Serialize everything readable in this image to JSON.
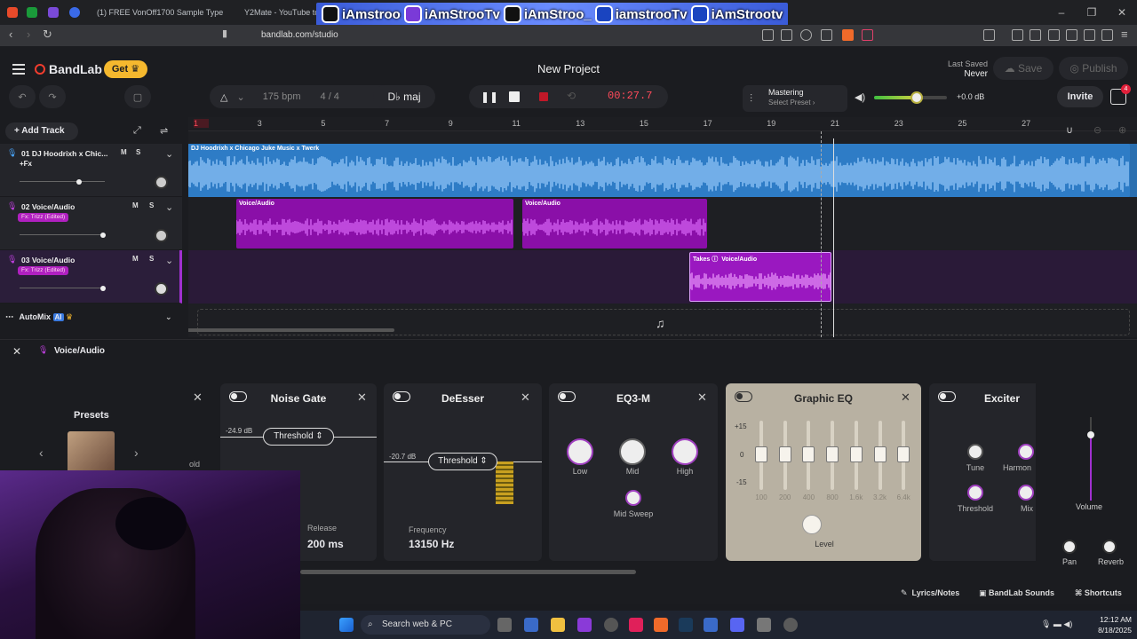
{
  "browser": {
    "tabs": [
      {
        "label": "(1) FREE VonOff1700 Sample Type Be"
      },
      {
        "label": "Y2Mate - YouTube to"
      }
    ],
    "url": "bandlab.com/studio"
  },
  "stream_overlay": {
    "instagram": "iAmstroo",
    "twitch": "iAmStrooTv",
    "tiktok": "iAmStroo_",
    "youtube": "iamstrooTv",
    "x": "iAmStrootv"
  },
  "app": {
    "logo": "BandLab",
    "get_label": "Get",
    "project_title": "New Project",
    "last_saved_label": "Last Saved",
    "last_saved_value": "Never",
    "save_label": "Save",
    "publish_label": "Publish",
    "invite_label": "Invite",
    "notification_count": "4"
  },
  "transport": {
    "bpm": "175",
    "bpm_unit": "bpm",
    "time_sig": "4 / 4",
    "key": "D♭ maj",
    "time": "00:27.7",
    "mastering_title": "Mastering",
    "mastering_sub": "Select Preset",
    "master_db": "+0.0 dB",
    "master_volume_fraction": 0.58
  },
  "tracks": {
    "add_track": "Add Track",
    "items": [
      {
        "name": "01  DJ Hoodrixh x Chic...",
        "sub": "+Fx",
        "clip": "DJ Hoodrixh x Chicago Juke Music x Twerk",
        "vol": 0.7
      },
      {
        "name": "02  Voice/Audio",
        "sub": "Fx: Trizz (Edited)",
        "clip": "Voice/Audio",
        "clip2": "Voice/Audio",
        "vol": 0.98
      },
      {
        "name": "03  Voice/Audio",
        "sub": "Fx: Trizz (Edited)",
        "clip": "Voice/Audio",
        "takes": "Takes",
        "vol": 0.98
      }
    ],
    "mute": "M",
    "solo": "S",
    "automix": "AutoMix",
    "ai": "AI"
  },
  "ruler": [
    "1",
    "3",
    "5",
    "7",
    "9",
    "11",
    "13",
    "15",
    "17",
    "19",
    "21",
    "23",
    "25",
    "27"
  ],
  "fx": {
    "track_label": "Voice/Audio",
    "presets_label": "Presets",
    "noise_gate": {
      "title": "Noise Gate",
      "db": "-24.9 dB",
      "threshold": "Threshold",
      "release_label": "Release",
      "release_value": "200 ms"
    },
    "deesser": {
      "title": "DeEsser",
      "db": "-20.7 dB",
      "threshold": "Threshold",
      "freq_label": "Frequency",
      "freq_value": "13150 Hz"
    },
    "eq3": {
      "title": "EQ3-M",
      "low": "Low",
      "mid": "Mid",
      "high": "High",
      "mid_sweep": "Mid Sweep"
    },
    "graphic_eq": {
      "title": "Graphic EQ",
      "scale": [
        "+15",
        "0",
        "-15"
      ],
      "bands": [
        "100",
        "200",
        "400",
        "800",
        "1.6k",
        "3.2k",
        "6.4k"
      ],
      "level": "Level"
    },
    "exciter": {
      "title": "Exciter",
      "tune": "Tune",
      "harmonics": "Harmon",
      "threshold": "Threshold",
      "mix": "Mix"
    },
    "volume_label": "Volume",
    "pan_label": "Pan",
    "reverb_label": "Reverb",
    "partial_left": "old"
  },
  "bottom": {
    "lyrics": "Lyrics/Notes",
    "sounds": "BandLab Sounds",
    "shortcuts": "Shortcuts"
  },
  "taskbar": {
    "search": "Search web & PC",
    "time": "12:12 AM",
    "date": "8/18/2025"
  }
}
